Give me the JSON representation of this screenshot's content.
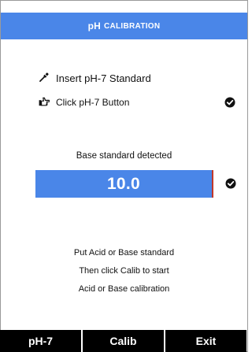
{
  "header": {
    "title_main": "pH",
    "title_sub": "CALIBRATION"
  },
  "steps": [
    {
      "icon": "dropper-icon",
      "label": "Insert pH-7 Standard"
    },
    {
      "icon": "pointing-hand-icon",
      "label": "Click pH-7 Button",
      "status": "check-circle-icon"
    }
  ],
  "detection": {
    "message": "Base standard detected",
    "value": "10.0",
    "status": "check-circle-icon"
  },
  "instructions": [
    "Put Acid or Base standard",
    "Then click Calib to start",
    "Acid or Base calibration"
  ],
  "buttons": {
    "ph7": "pH-7",
    "calib": "Calib",
    "exit": "Exit"
  },
  "colors": {
    "accent": "#4a86e8",
    "footer": "#000000"
  }
}
